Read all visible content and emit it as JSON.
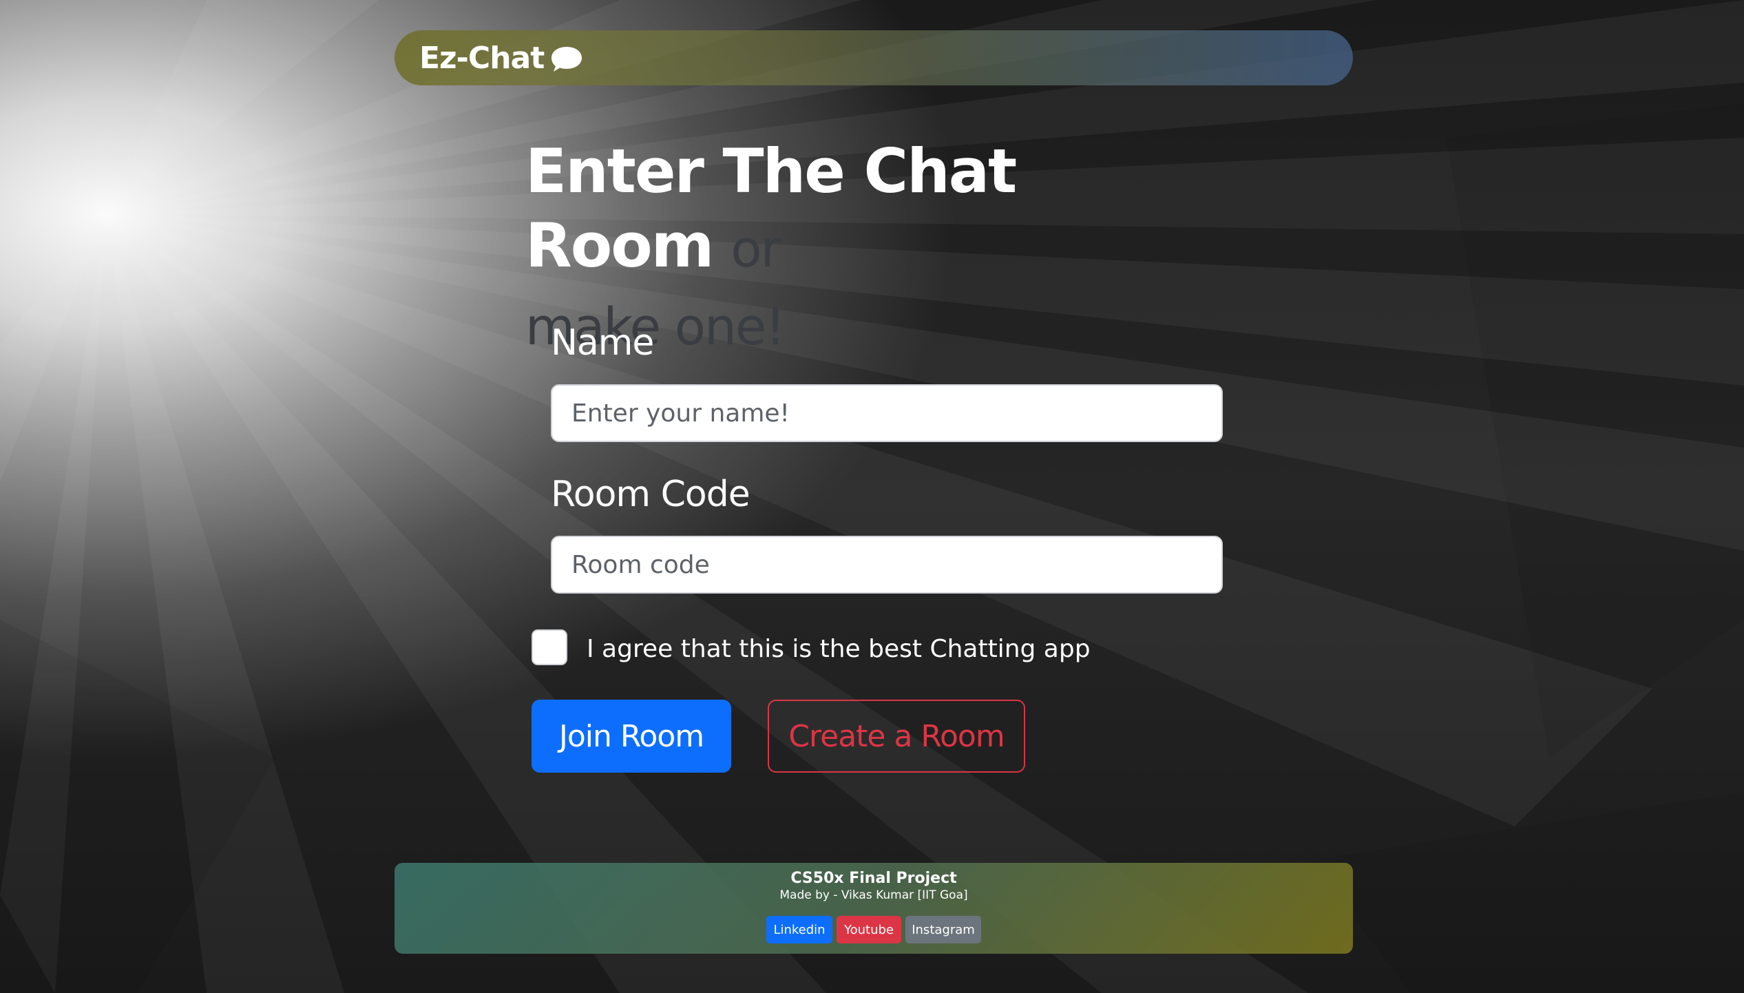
{
  "navbar": {
    "brand": "Ez-Chat",
    "brand_icon": "speech-bubble-icon"
  },
  "heading": {
    "main": "Enter The Chat Room",
    "sub_or": "or",
    "sub_rest": "make one!"
  },
  "form": {
    "name_label": "Name",
    "name_placeholder": "Enter your name!",
    "room_label": "Room Code",
    "room_placeholder": "Room code",
    "agree_label": "I agree that this is the best Chatting app",
    "join_button": "Join Room",
    "create_button": "Create a Room"
  },
  "footer": {
    "title": "CS50x Final Project",
    "credit": "Made by - Vikas Kumar [IIT Goa]",
    "links": {
      "linkedin": "Linkedin",
      "youtube": "Youtube",
      "instagram": "Instagram"
    }
  },
  "colors": {
    "primary": "#0d6efd",
    "danger": "#dc3545",
    "secondary": "#6c757d"
  }
}
